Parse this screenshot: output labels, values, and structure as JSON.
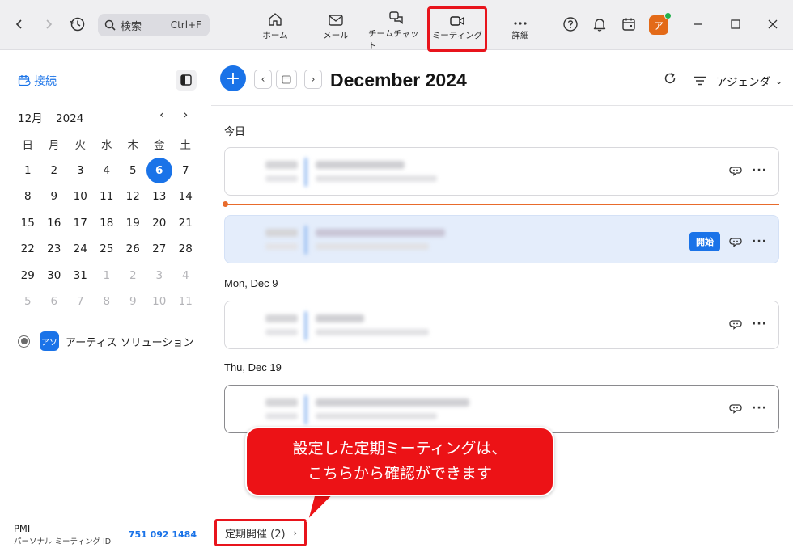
{
  "titlebar": {
    "search_placeholder": "検索",
    "search_shortcut": "Ctrl+F",
    "tabs": [
      {
        "label": "ホーム",
        "icon": "home-icon"
      },
      {
        "label": "メール",
        "icon": "mail-icon"
      },
      {
        "label": "チームチャット",
        "icon": "chat-icon"
      },
      {
        "label": "ミーティング",
        "icon": "video-camera-icon"
      },
      {
        "label": "詳細",
        "icon": "more-horizontal-icon"
      }
    ],
    "active_tab": "ミーティング",
    "avatar_initial": "ア",
    "presence_color": "#22b14c",
    "accent_highlight": "#e8141c"
  },
  "sidebar": {
    "connect_label": "接続",
    "calendar": {
      "month": "12月",
      "year": "2024",
      "weekdays": [
        "日",
        "月",
        "火",
        "水",
        "木",
        "金",
        "土"
      ],
      "weeks": [
        [
          "1",
          "2",
          "3",
          "4",
          "5",
          "6",
          "7"
        ],
        [
          "8",
          "9",
          "10",
          "11",
          "12",
          "13",
          "14"
        ],
        [
          "15",
          "16",
          "17",
          "18",
          "19",
          "20",
          "21"
        ],
        [
          "22",
          "23",
          "24",
          "25",
          "26",
          "27",
          "28"
        ],
        [
          "29",
          "30",
          "31",
          "1",
          "2",
          "3",
          "4"
        ],
        [
          "5",
          "6",
          "7",
          "8",
          "9",
          "10",
          "11"
        ]
      ],
      "today": "6"
    },
    "account": {
      "badge": "アソ",
      "name": "アーティス ソリューション"
    },
    "pmi": {
      "label": "PMI",
      "sub_label": "パーソナル ミーティング ID",
      "number": "751 092 1484"
    }
  },
  "main": {
    "month_title": "December 2024",
    "view_label": "アジェンダ",
    "sections": [
      {
        "label": "今日"
      },
      {
        "label": "Mon, Dec 9"
      },
      {
        "label": "Thu, Dec 19"
      }
    ],
    "start_button_label": "開始",
    "recurring_label": "定期開催 (2)",
    "accent_color": "#1a73e8",
    "now_line_color": "#e86b2c"
  },
  "callout": {
    "line1": "設定した定期ミーティングは、",
    "line2": "こちらから確認ができます"
  }
}
